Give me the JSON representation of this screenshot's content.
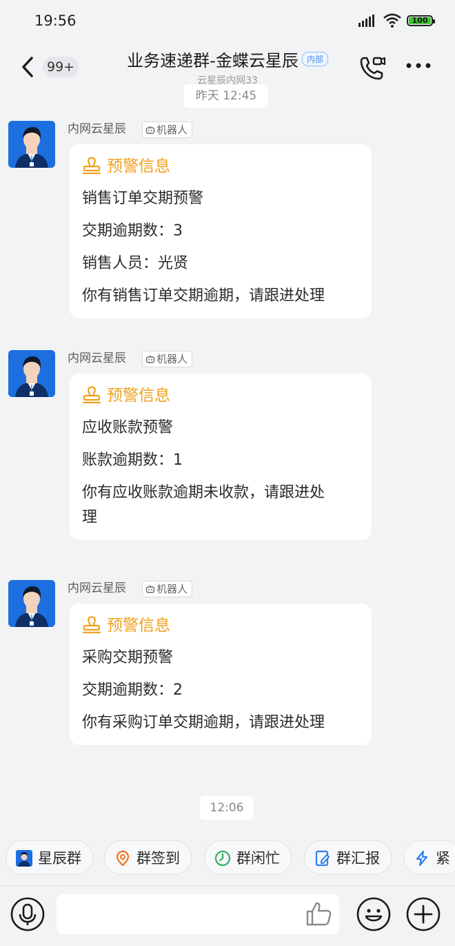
{
  "status_bar": {
    "time": "19:56",
    "battery": "100"
  },
  "header": {
    "back_count": "99+",
    "title": "业务速递群-金蝶云星辰",
    "tag": "内部",
    "subtitle": "云星辰内网33"
  },
  "timestamps": {
    "top": "昨天 12:45",
    "bottom": "12:06"
  },
  "messages": [
    {
      "sender": "内网云星辰",
      "tag": "机器人",
      "title": "预警信息",
      "lines": [
        "销售订单交期预警",
        "交期逾期数：3",
        "销售人员：光贤",
        "你有销售订单交期逾期，请跟进处理"
      ]
    },
    {
      "sender": "内网云星辰",
      "tag": "机器人",
      "title": "预警信息",
      "lines": [
        "应收账款预警",
        "账款逾期数：1",
        "你有应收账款逾期未收款，请跟进处",
        "理"
      ]
    },
    {
      "sender": "内网云星辰",
      "tag": "机器人",
      "title": "预警信息",
      "lines": [
        "采购交期预警",
        "交期逾期数：2",
        "你有采购订单交期逾期，请跟进处理"
      ]
    }
  ],
  "quick_actions": [
    {
      "label": "星辰群",
      "icon": "group-avatar-icon"
    },
    {
      "label": "群签到",
      "icon": "location-pin-icon"
    },
    {
      "label": "群闲忙",
      "icon": "clock-icon"
    },
    {
      "label": "群汇报",
      "icon": "report-edit-icon"
    },
    {
      "label": "紧",
      "icon": "lightning-icon"
    }
  ],
  "colors": {
    "accent_orange": "#f0a01c",
    "tag_blue": "#3f8ff0",
    "background": "#f2f3f5"
  }
}
